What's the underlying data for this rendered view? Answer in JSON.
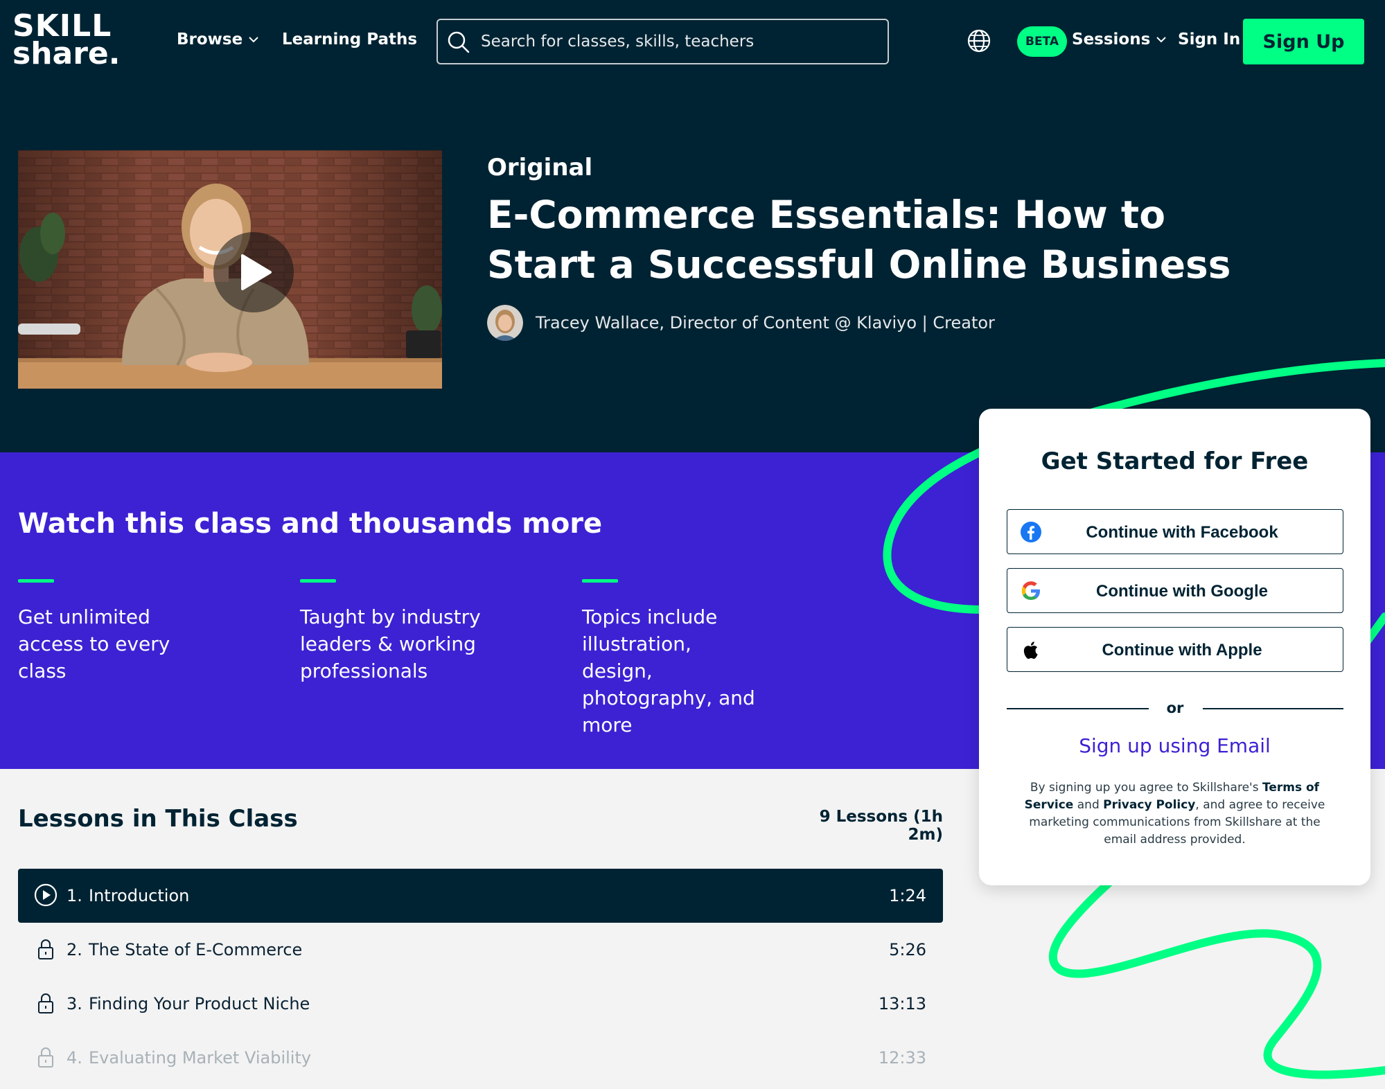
{
  "header": {
    "logo_line1": "SKILL",
    "logo_line2": "share.",
    "browse_label": "Browse",
    "learning_paths_label": "Learning Paths",
    "search_placeholder": "Search for classes, skills, teachers",
    "beta_badge": "BETA",
    "sessions_label": "Sessions",
    "sign_in_label": "Sign In",
    "sign_up_label": "Sign Up"
  },
  "hero": {
    "eyebrow": "Original",
    "title": "E-Commerce Essentials: How to Start a Successful Online Business",
    "teacher": "Tracey Wallace, Director of Content @ Klaviyo | Creator"
  },
  "promo": {
    "title": "Watch this class and thousands more",
    "features": [
      {
        "text": "Get unlimited access to every class"
      },
      {
        "text": "Taught by industry leaders & working professionals"
      },
      {
        "text": "Topics include illustration, design, photography, and more"
      }
    ]
  },
  "lessons": {
    "title": "Lessons in This Class",
    "count": "9 Lessons (1h 2m)",
    "items": [
      {
        "num": "1.",
        "name": "Introduction",
        "duration": "1:24",
        "state": "playing"
      },
      {
        "num": "2.",
        "name": "The State of E-Commerce",
        "duration": "5:26",
        "state": "locked"
      },
      {
        "num": "3.",
        "name": "Finding Your Product Niche",
        "duration": "13:13",
        "state": "locked"
      },
      {
        "num": "4.",
        "name": "Evaluating Market Viability",
        "duration": "12:33",
        "state": "locked"
      }
    ]
  },
  "signup_card": {
    "title": "Get Started for Free",
    "facebook_label": "Continue with Facebook",
    "google_label": "Continue with Google",
    "apple_label": "Continue with Apple",
    "or_label": "or",
    "email_label": "Sign up using Email",
    "legal_prefix": "By signing up you agree to Skillshare's ",
    "terms_label": "Terms of Service",
    "legal_and": " and ",
    "privacy_label": "Privacy Policy",
    "legal_suffix": ", and agree to receive marketing communications from Skillshare at the email address provided."
  },
  "colors": {
    "navy": "#002333",
    "brand_green": "#00ff84",
    "purple": "#3c22d3",
    "lessons_bg": "#f3f3f3",
    "facebook_blue": "#1877f2"
  },
  "icons": {
    "search": "search-icon",
    "globe": "globe-icon",
    "chevron": "chevron-down-icon",
    "play": "play-icon",
    "lock": "lock-icon",
    "facebook": "facebook-icon",
    "google": "google-icon",
    "apple": "apple-icon"
  }
}
